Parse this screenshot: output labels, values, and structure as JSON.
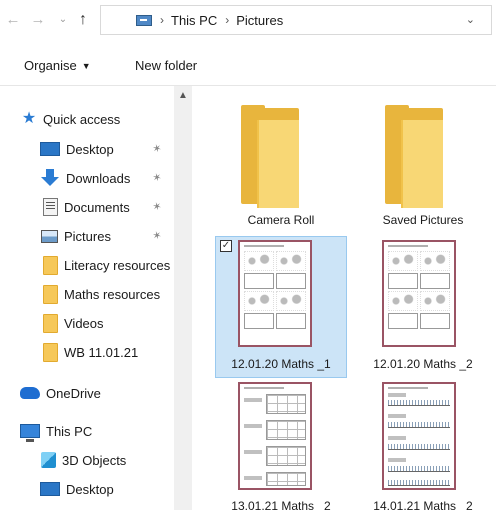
{
  "address": {
    "crumbs": [
      "This PC",
      "Pictures"
    ]
  },
  "toolbar": {
    "organise_label": "Organise",
    "new_folder_label": "New folder"
  },
  "nav": {
    "quick_access": "Quick access",
    "items": [
      {
        "label": "Desktop",
        "icon": "desktop-icon",
        "pinned": true
      },
      {
        "label": "Downloads",
        "icon": "download-icon",
        "pinned": true
      },
      {
        "label": "Documents",
        "icon": "documents-icon",
        "pinned": true
      },
      {
        "label": "Pictures",
        "icon": "pictures-icon",
        "pinned": true
      },
      {
        "label": "Literacy resources",
        "icon": "folder-icon",
        "pinned": false
      },
      {
        "label": "Maths resources",
        "icon": "folder-icon",
        "pinned": false
      },
      {
        "label": "Videos",
        "icon": "folder-icon",
        "pinned": false
      },
      {
        "label": "WB 11.01.21",
        "icon": "folder-icon",
        "pinned": false
      }
    ],
    "onedrive": "OneDrive",
    "this_pc": "This PC",
    "pc_items": [
      {
        "label": "3D Objects",
        "icon": "3d-objects-icon"
      },
      {
        "label": "Desktop",
        "icon": "desktop-icon"
      }
    ]
  },
  "content": {
    "items": [
      {
        "name": "Camera Roll",
        "type": "folder"
      },
      {
        "name": "Saved Pictures",
        "type": "folder"
      },
      {
        "name": "12.01.20 Maths _1",
        "type": "image",
        "selected": true,
        "checked": true
      },
      {
        "name": "12.01.20 Maths _2",
        "type": "image",
        "selected": false
      },
      {
        "name": "13.01.21 Maths _2",
        "type": "image",
        "selected": false
      },
      {
        "name": "14.01.21 Maths _2",
        "type": "image",
        "selected": false
      }
    ]
  },
  "colors": {
    "selection_bg": "#cce4f7",
    "selection_border": "#99c9ef",
    "accent": "#2b7cd3",
    "folder": "#f8d775",
    "thumb_border": "#9a5464"
  }
}
